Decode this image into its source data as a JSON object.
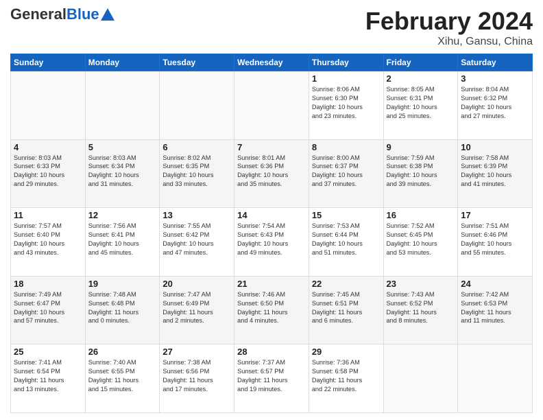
{
  "header": {
    "logo_general": "General",
    "logo_blue": "Blue",
    "title": "February 2024",
    "location": "Xihu, Gansu, China"
  },
  "days_of_week": [
    "Sunday",
    "Monday",
    "Tuesday",
    "Wednesday",
    "Thursday",
    "Friday",
    "Saturday"
  ],
  "weeks": [
    [
      {
        "day": "",
        "info": ""
      },
      {
        "day": "",
        "info": ""
      },
      {
        "day": "",
        "info": ""
      },
      {
        "day": "",
        "info": ""
      },
      {
        "day": "1",
        "info": "Sunrise: 8:06 AM\nSunset: 6:30 PM\nDaylight: 10 hours\nand 23 minutes."
      },
      {
        "day": "2",
        "info": "Sunrise: 8:05 AM\nSunset: 6:31 PM\nDaylight: 10 hours\nand 25 minutes."
      },
      {
        "day": "3",
        "info": "Sunrise: 8:04 AM\nSunset: 6:32 PM\nDaylight: 10 hours\nand 27 minutes."
      }
    ],
    [
      {
        "day": "4",
        "info": "Sunrise: 8:03 AM\nSunset: 6:33 PM\nDaylight: 10 hours\nand 29 minutes."
      },
      {
        "day": "5",
        "info": "Sunrise: 8:03 AM\nSunset: 6:34 PM\nDaylight: 10 hours\nand 31 minutes."
      },
      {
        "day": "6",
        "info": "Sunrise: 8:02 AM\nSunset: 6:35 PM\nDaylight: 10 hours\nand 33 minutes."
      },
      {
        "day": "7",
        "info": "Sunrise: 8:01 AM\nSunset: 6:36 PM\nDaylight: 10 hours\nand 35 minutes."
      },
      {
        "day": "8",
        "info": "Sunrise: 8:00 AM\nSunset: 6:37 PM\nDaylight: 10 hours\nand 37 minutes."
      },
      {
        "day": "9",
        "info": "Sunrise: 7:59 AM\nSunset: 6:38 PM\nDaylight: 10 hours\nand 39 minutes."
      },
      {
        "day": "10",
        "info": "Sunrise: 7:58 AM\nSunset: 6:39 PM\nDaylight: 10 hours\nand 41 minutes."
      }
    ],
    [
      {
        "day": "11",
        "info": "Sunrise: 7:57 AM\nSunset: 6:40 PM\nDaylight: 10 hours\nand 43 minutes."
      },
      {
        "day": "12",
        "info": "Sunrise: 7:56 AM\nSunset: 6:41 PM\nDaylight: 10 hours\nand 45 minutes."
      },
      {
        "day": "13",
        "info": "Sunrise: 7:55 AM\nSunset: 6:42 PM\nDaylight: 10 hours\nand 47 minutes."
      },
      {
        "day": "14",
        "info": "Sunrise: 7:54 AM\nSunset: 6:43 PM\nDaylight: 10 hours\nand 49 minutes."
      },
      {
        "day": "15",
        "info": "Sunrise: 7:53 AM\nSunset: 6:44 PM\nDaylight: 10 hours\nand 51 minutes."
      },
      {
        "day": "16",
        "info": "Sunrise: 7:52 AM\nSunset: 6:45 PM\nDaylight: 10 hours\nand 53 minutes."
      },
      {
        "day": "17",
        "info": "Sunrise: 7:51 AM\nSunset: 6:46 PM\nDaylight: 10 hours\nand 55 minutes."
      }
    ],
    [
      {
        "day": "18",
        "info": "Sunrise: 7:49 AM\nSunset: 6:47 PM\nDaylight: 10 hours\nand 57 minutes."
      },
      {
        "day": "19",
        "info": "Sunrise: 7:48 AM\nSunset: 6:48 PM\nDaylight: 11 hours\nand 0 minutes."
      },
      {
        "day": "20",
        "info": "Sunrise: 7:47 AM\nSunset: 6:49 PM\nDaylight: 11 hours\nand 2 minutes."
      },
      {
        "day": "21",
        "info": "Sunrise: 7:46 AM\nSunset: 6:50 PM\nDaylight: 11 hours\nand 4 minutes."
      },
      {
        "day": "22",
        "info": "Sunrise: 7:45 AM\nSunset: 6:51 PM\nDaylight: 11 hours\nand 6 minutes."
      },
      {
        "day": "23",
        "info": "Sunrise: 7:43 AM\nSunset: 6:52 PM\nDaylight: 11 hours\nand 8 minutes."
      },
      {
        "day": "24",
        "info": "Sunrise: 7:42 AM\nSunset: 6:53 PM\nDaylight: 11 hours\nand 11 minutes."
      }
    ],
    [
      {
        "day": "25",
        "info": "Sunrise: 7:41 AM\nSunset: 6:54 PM\nDaylight: 11 hours\nand 13 minutes."
      },
      {
        "day": "26",
        "info": "Sunrise: 7:40 AM\nSunset: 6:55 PM\nDaylight: 11 hours\nand 15 minutes."
      },
      {
        "day": "27",
        "info": "Sunrise: 7:38 AM\nSunset: 6:56 PM\nDaylight: 11 hours\nand 17 minutes."
      },
      {
        "day": "28",
        "info": "Sunrise: 7:37 AM\nSunset: 6:57 PM\nDaylight: 11 hours\nand 19 minutes."
      },
      {
        "day": "29",
        "info": "Sunrise: 7:36 AM\nSunset: 6:58 PM\nDaylight: 11 hours\nand 22 minutes."
      },
      {
        "day": "",
        "info": ""
      },
      {
        "day": "",
        "info": ""
      }
    ]
  ]
}
